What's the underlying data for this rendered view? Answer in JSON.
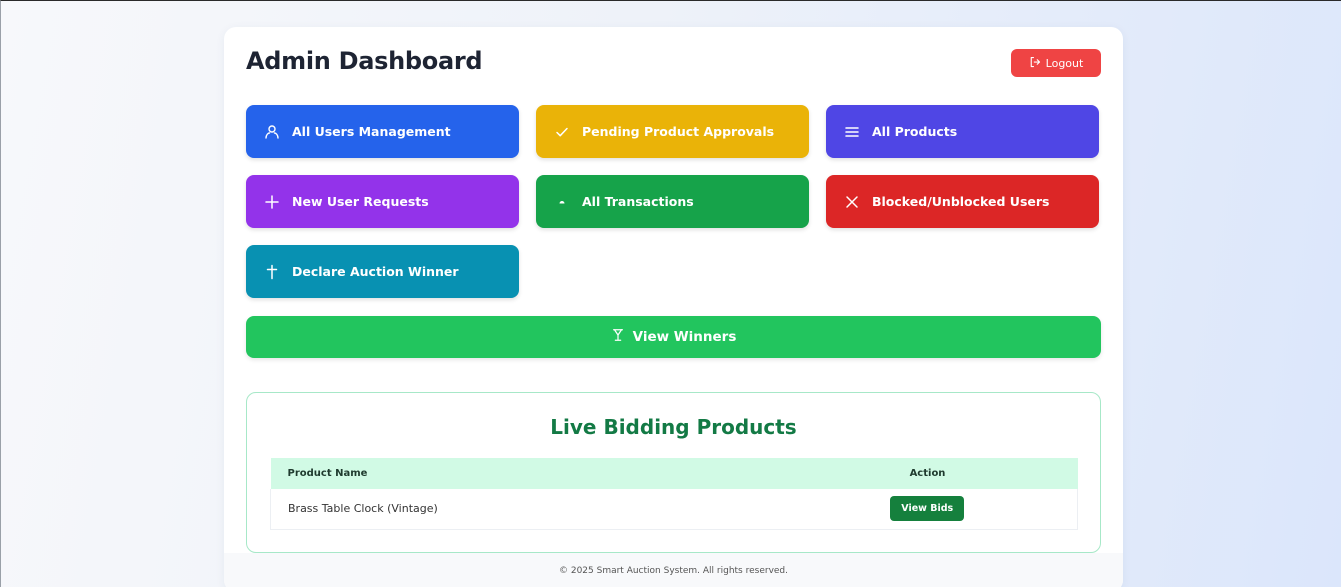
{
  "header": {
    "title": "Admin Dashboard",
    "logout_label": "Logout"
  },
  "tiles": [
    {
      "label": "All Users Management",
      "icon": "users-icon",
      "color": "#2563eb"
    },
    {
      "label": "Pending Product Approvals",
      "icon": "check-icon",
      "color": "#eab308"
    },
    {
      "label": "All Products",
      "icon": "menu-icon",
      "color": "#4f46e5"
    },
    {
      "label": "New User Requests",
      "icon": "plus-icon",
      "color": "#9333ea"
    },
    {
      "label": "All Transactions",
      "icon": "dot-icon",
      "color": "#16a34a"
    },
    {
      "label": "Blocked/Unblocked Users",
      "icon": "x-icon",
      "color": "#dc2626"
    },
    {
      "label": "Declare Auction Winner",
      "icon": "dagger-icon",
      "color": "#0891b2"
    }
  ],
  "winners_button": {
    "label": "View Winners",
    "icon": "trophy-icon",
    "color": "#22c55e"
  },
  "live_bidding": {
    "title": "Live Bidding Products",
    "columns": [
      "Product Name",
      "Action"
    ],
    "rows": [
      {
        "product": "Brass Table Clock (Vintage)",
        "action_label": "View Bids"
      }
    ]
  },
  "footer": {
    "text": "© 2025 Smart Auction System. All rights reserved."
  }
}
